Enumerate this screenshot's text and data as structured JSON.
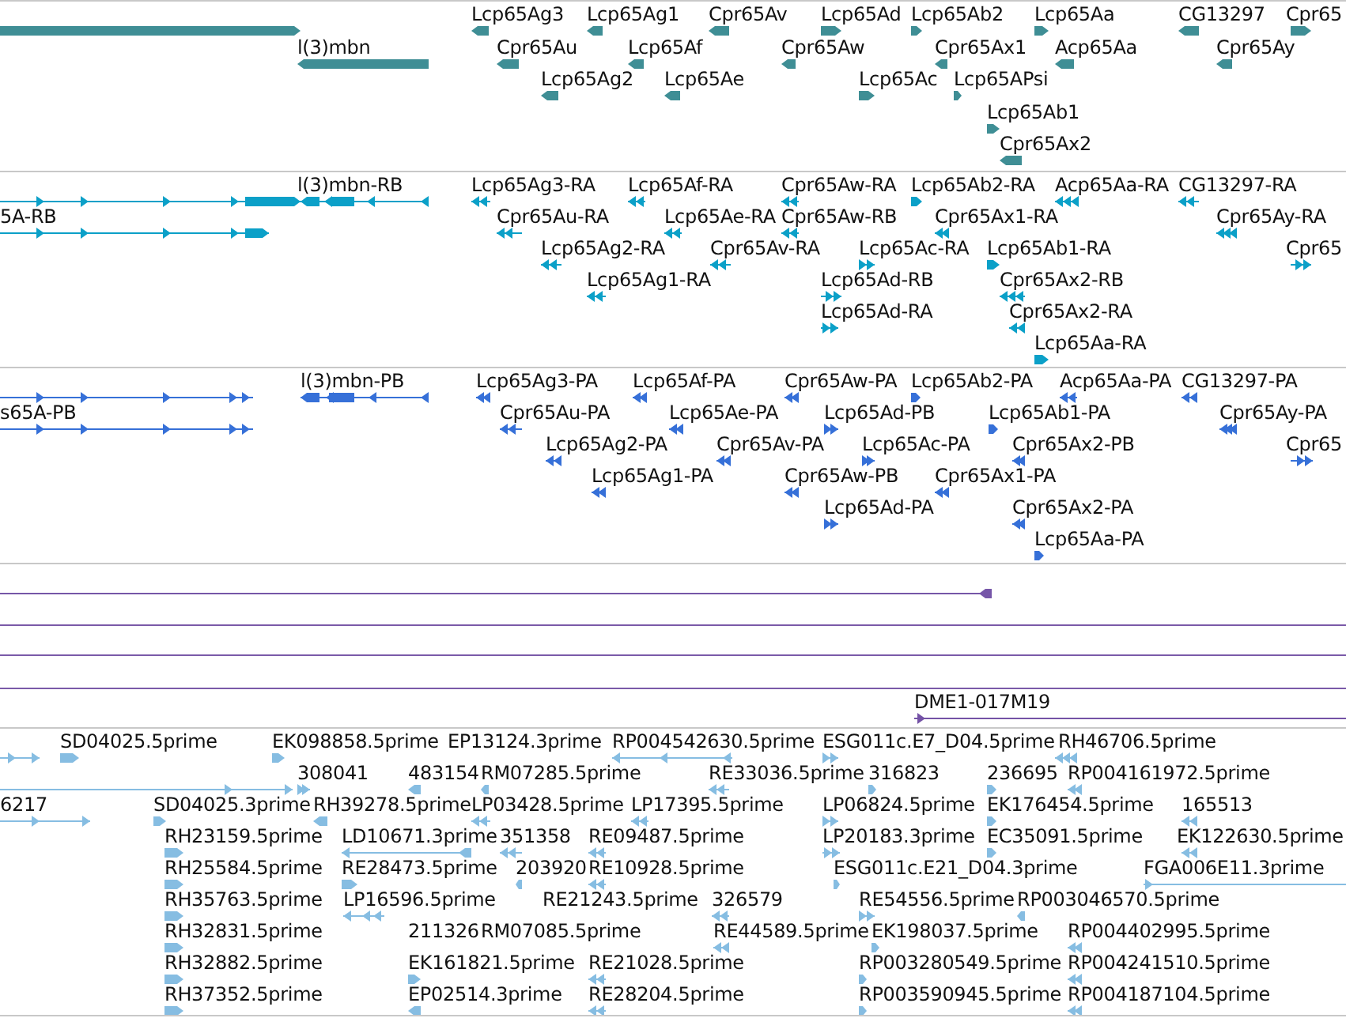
{
  "tracks": [
    {
      "kind": "gene",
      "features": [
        {
          "reverse": false
        },
        {
          "label": "Lcp65Ag3",
          "reverse": true
        },
        {
          "label": "Lcp65Ag1",
          "reverse": true
        },
        {
          "label": "Cpr65Av",
          "reverse": true
        },
        {
          "label": "Lcp65Ad",
          "reverse": false
        },
        {
          "label": "Lcp65Ab2",
          "reverse": false
        },
        {
          "label": "Lcp65Aa",
          "reverse": false
        },
        {
          "label": "CG13297",
          "reverse": true
        },
        {
          "label": "Cpr65",
          "reverse": false
        },
        {
          "label": "l(3)mbn",
          "reverse": true
        },
        {
          "label": "Cpr65Au",
          "reverse": true
        },
        {
          "label": "Lcp65Af",
          "reverse": true
        },
        {
          "label": "Cpr65Aw",
          "reverse": true
        },
        {
          "label": "Cpr65Ax1",
          "reverse": true
        },
        {
          "label": "Acp65Aa",
          "reverse": true
        },
        {
          "label": "Cpr65Ay",
          "reverse": true
        },
        {
          "label": "Lcp65Ag2",
          "reverse": true
        },
        {
          "label": "Lcp65Ae",
          "reverse": true
        },
        {
          "label": "Lcp65Ac",
          "reverse": false
        },
        {
          "label": "Lcp65APsi",
          "reverse": false
        },
        {
          "label": "Lcp65Ab1",
          "reverse": false
        },
        {
          "label": "Cpr65Ax2",
          "reverse": true
        }
      ]
    },
    {
      "kind": "transcript",
      "features": [
        {
          "reverse": false
        },
        {
          "label": "l(3)mbn-RB",
          "reverse": true
        },
        {
          "label": "Lcp65Ag3-RA",
          "reverse": true
        },
        {
          "label": "Lcp65Af-RA",
          "reverse": true
        },
        {
          "label": "Cpr65Aw-RA",
          "reverse": true
        },
        {
          "label": "Lcp65Ab2-RA",
          "reverse": false
        },
        {
          "label": "Acp65Aa-RA",
          "reverse": true
        },
        {
          "label": "CG13297-RA",
          "reverse": true
        },
        {
          "label": "5A-RB",
          "reverse": false
        },
        {
          "label": "Cpr65Au-RA",
          "reverse": true
        },
        {
          "label": "Lcp65Ae-RA",
          "reverse": true
        },
        {
          "label": "Cpr65Aw-RB",
          "reverse": true
        },
        {
          "label": "Cpr65Ax1-RA",
          "reverse": true
        },
        {
          "label": "Cpr65Ay-RA",
          "reverse": true
        },
        {
          "label": "Lcp65Ag2-RA",
          "reverse": true
        },
        {
          "label": "Cpr65Av-RA",
          "reverse": true
        },
        {
          "label": "Lcp65Ac-RA",
          "reverse": false
        },
        {
          "label": "Lcp65Ab1-RA",
          "reverse": false
        },
        {
          "label": "Cpr65",
          "reverse": false
        },
        {
          "label": "Lcp65Ag1-RA",
          "reverse": true
        },
        {
          "label": "Lcp65Ad-RB",
          "reverse": false
        },
        {
          "label": "Cpr65Ax2-RB",
          "reverse": true
        },
        {
          "label": "Lcp65Ad-RA",
          "reverse": false
        },
        {
          "label": "Cpr65Ax2-RA",
          "reverse": true
        },
        {
          "label": "Lcp65Aa-RA",
          "reverse": false
        }
      ]
    },
    {
      "kind": "polypeptide",
      "features": [
        {
          "reverse": false
        },
        {
          "label": "l(3)mbn-PB",
          "reverse": true
        },
        {
          "label": "Lcp65Ag3-PA",
          "reverse": true
        },
        {
          "label": "Lcp65Af-PA",
          "reverse": true
        },
        {
          "label": "Cpr65Aw-PA",
          "reverse": true
        },
        {
          "label": "Lcp65Ab2-PA",
          "reverse": false
        },
        {
          "label": "Acp65Aa-PA",
          "reverse": true
        },
        {
          "label": "CG13297-PA",
          "reverse": true
        },
        {
          "label": "s65A-PB",
          "reverse": false
        },
        {
          "label": "Cpr65Au-PA",
          "reverse": true
        },
        {
          "label": "Lcp65Ae-PA",
          "reverse": true
        },
        {
          "label": "Lcp65Ad-PB",
          "reverse": false
        },
        {
          "label": "Lcp65Ab1-PA",
          "reverse": false
        },
        {
          "label": "Cpr65Ay-PA",
          "reverse": true
        },
        {
          "label": "Lcp65Ag2-PA",
          "reverse": true
        },
        {
          "label": "Cpr65Av-PA",
          "reverse": true
        },
        {
          "label": "Lcp65Ac-PA",
          "reverse": false
        },
        {
          "label": "Cpr65Ax2-PB",
          "reverse": true
        },
        {
          "label": "Cpr65",
          "reverse": false
        },
        {
          "label": "Lcp65Ag1-PA",
          "reverse": true
        },
        {
          "label": "Cpr65Aw-PB",
          "reverse": true
        },
        {
          "label": "Cpr65Ax1-PA",
          "reverse": true
        },
        {
          "label": "Lcp65Ad-PA",
          "reverse": false
        },
        {
          "label": "Cpr65Ax2-PA",
          "reverse": true
        },
        {
          "label": "Lcp65Aa-PA",
          "reverse": false
        }
      ]
    },
    {
      "kind": "rule",
      "features": [
        {
          "reverse": true
        }
      ]
    },
    {
      "kind": "empty"
    },
    {
      "kind": "empty"
    },
    {
      "kind": "clone",
      "features": [
        {
          "label": "DME1-017M19",
          "reverse": false
        }
      ]
    },
    {
      "kind": "est",
      "features": [
        {
          "reverse": false
        },
        {
          "label": "SD04025.5prime",
          "reverse": false
        },
        {
          "label": "EK098858.5prime",
          "reverse": false
        },
        {
          "label": "EP13124.3prime"
        },
        {
          "label": "RP004542630.5prime",
          "reverse": true
        },
        {
          "label": "ESG011c.E7_D04.5prime",
          "reverse": false
        },
        {
          "label": "RH46706.5prime",
          "reverse": true
        },
        {
          "reverse": false
        },
        {
          "label": "308041",
          "reverse": false
        },
        {
          "label": "483154",
          "reverse": true
        },
        {
          "label": "RM07285.5prime",
          "reverse": true
        },
        {
          "label": "RE33036.5prime",
          "reverse": true
        },
        {
          "label": "316823",
          "reverse": false
        },
        {
          "label": "236695",
          "reverse": false
        },
        {
          "label": "RP004161972.5prime",
          "reverse": true
        },
        {
          "label": "6217",
          "reverse": false
        },
        {
          "label": "SD04025.3prime",
          "reverse": false
        },
        {
          "label": "RH39278.5prime",
          "reverse": true
        },
        {
          "label": "LP03428.5prime",
          "reverse": true
        },
        {
          "label": "LP17395.5prime",
          "reverse": true
        },
        {
          "label": "LP06824.5prime",
          "reverse": false
        },
        {
          "label": "EK176454.5prime",
          "reverse": false
        },
        {
          "label": "165513",
          "reverse": true
        },
        {
          "label": "RH23159.5prime",
          "reverse": false
        },
        {
          "label": "LD10671.3prime",
          "reverse": true
        },
        {
          "label": "351358",
          "reverse": true
        },
        {
          "label": "RE09487.5prime",
          "reverse": true
        },
        {
          "label": "LP20183.3prime",
          "reverse": false
        },
        {
          "label": "EC35091.5prime",
          "reverse": false
        },
        {
          "label": "EK122630.5prime",
          "reverse": true
        },
        {
          "label": "RH25584.5prime",
          "reverse": false
        },
        {
          "label": "RE28473.5prime",
          "reverse": false
        },
        {
          "label": "203920",
          "reverse": true
        },
        {
          "label": "RE10928.5prime",
          "reverse": true
        },
        {
          "label": "ESG011c.E21_D04.3prime",
          "reverse": false
        },
        {
          "label": "FGA006E11.3prime",
          "reverse": false
        },
        {
          "label": "RH35763.5prime",
          "reverse": false
        },
        {
          "label": "LP16596.5prime",
          "reverse": true
        },
        {
          "label": "RE21243.5prime"
        },
        {
          "label": "326579",
          "reverse": true
        },
        {
          "label": "RE54556.5prime",
          "reverse": false
        },
        {
          "label": "RP003046570.5prime",
          "reverse": true
        },
        {
          "label": "RH32831.5prime",
          "reverse": false
        },
        {
          "label": "211326"
        },
        {
          "label": "RM07085.5prime"
        },
        {
          "label": "RE44589.5prime",
          "reverse": true
        },
        {
          "label": "EK198037.5prime",
          "reverse": false
        },
        {
          "label": "RP004402995.5prime",
          "reverse": true
        },
        {
          "label": "RH32882.5prime",
          "reverse": false
        },
        {
          "label": "EK161821.5prime",
          "reverse": false
        },
        {
          "label": "RE21028.5prime",
          "reverse": true
        },
        {
          "label": "RP003280549.5prime",
          "reverse": false
        },
        {
          "label": "RP004241510.5prime",
          "reverse": true
        },
        {
          "label": "RH37352.5prime",
          "reverse": false
        },
        {
          "label": "EP02514.3prime",
          "reverse": true
        },
        {
          "label": "RE28204.5prime",
          "reverse": true
        },
        {
          "label": "RP003590945.5prime",
          "reverse": false
        },
        {
          "label": "RP004187104.5prime",
          "reverse": true
        }
      ]
    }
  ]
}
